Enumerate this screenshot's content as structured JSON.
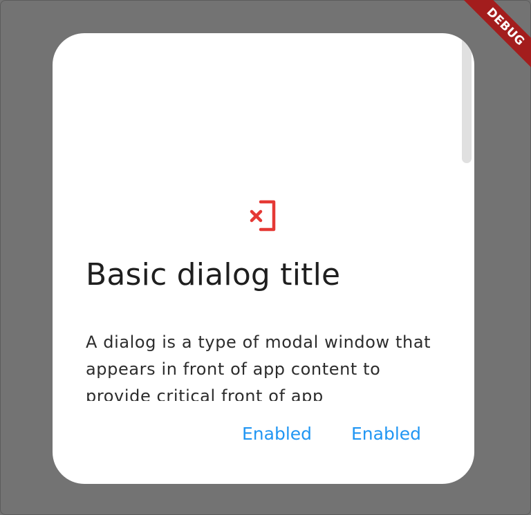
{
  "dialog": {
    "icon": "phonelink-erase-icon",
    "title": "Basic dialog title",
    "body": "A dialog is a type of modal window that appears in front of app content to provide critical front of app",
    "actions": [
      {
        "label": "Enabled"
      },
      {
        "label": "Enabled"
      }
    ]
  },
  "debug_banner": {
    "label": "DEBUG"
  },
  "colors": {
    "scrim": "#737373",
    "surface": "#ffffff",
    "icon": "#e53935",
    "action": "#2196f3",
    "banner": "#a31d1d"
  }
}
